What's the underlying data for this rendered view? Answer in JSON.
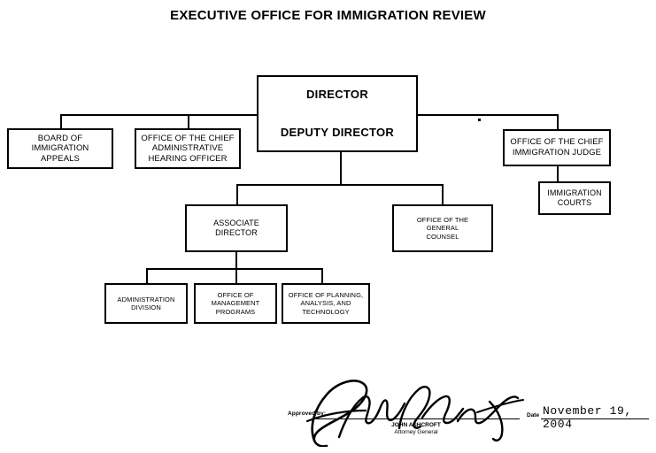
{
  "title": "EXECUTIVE OFFICE FOR IMMIGRATION REVIEW",
  "nodes": {
    "director": "DIRECTOR",
    "deputy_director": "DEPUTY DIRECTOR",
    "board_of_immigration_appeals": "BOARD OF\nIMMIGRATION\nAPPEALS",
    "office_chief_administrative_hearing_officer": "OFFICE OF THE CHIEF\nADMINISTRATIVE\nHEARING OFFICER",
    "office_chief_immigration_judge": "OFFICE OF THE CHIEF\nIMMIGRATION JUDGE",
    "immigration_courts": "IMMIGRATION\nCOURTS",
    "associate_director": "ASSOCIATE\nDIRECTOR",
    "office_general_counsel": "OFFICE OF THE\nGENERAL\nCOUNSEL",
    "administration_division": "ADMINISTRATION\nDIVISION",
    "office_management_programs": "OFFICE OF\nMANAGEMENT\nPROGRAMS",
    "office_planning_analysis_technology": "OFFICE OF PLANNING,\nANALYSIS, AND\nTECHNOLOGY"
  },
  "signature": {
    "approved_by_label": "Approved by:",
    "name": "JOHN ASHCROFT",
    "title": "Attorney General",
    "date_label": "Date",
    "date_value": "November 19, 2004"
  },
  "colors": {
    "ink": "#000000",
    "paper": "#ffffff"
  }
}
